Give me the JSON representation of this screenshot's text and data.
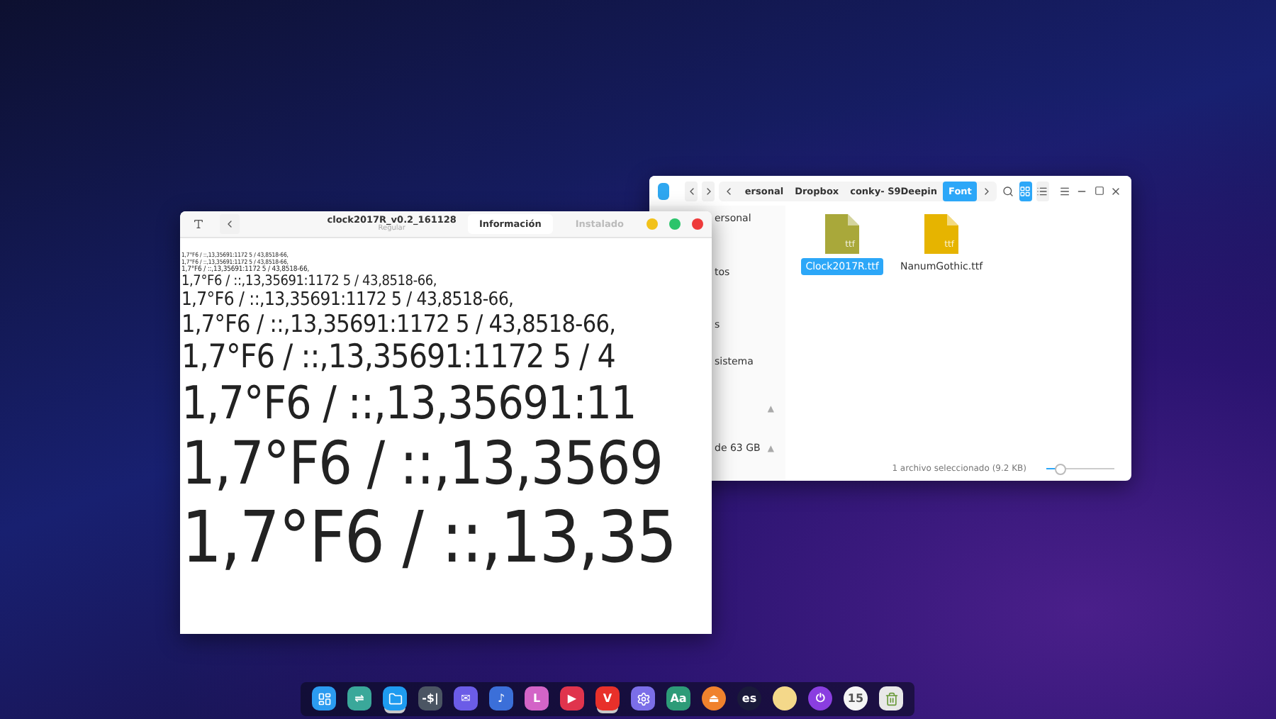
{
  "file_manager": {
    "breadcrumb": [
      {
        "label": "ersonal",
        "selected": false
      },
      {
        "label": "Dropbox",
        "selected": false
      },
      {
        "label": "conky- S9Deepin",
        "selected": false
      },
      {
        "label": "Font",
        "selected": true
      }
    ],
    "view_modes": [
      {
        "kind": "grid",
        "selected": true
      },
      {
        "kind": "list",
        "selected": false
      }
    ],
    "sidebar": [
      {
        "label": "ersonal"
      },
      {
        "label": "tos"
      },
      {
        "label": "s"
      },
      {
        "label": "sistema"
      },
      {
        "eject": "▲"
      },
      {
        "label": "de 63 GB",
        "eject": "▲"
      }
    ],
    "files": [
      {
        "name": "Clock2017R.ttf",
        "ext": "ttf",
        "selected": true,
        "color": "#a9a83a"
      },
      {
        "name": "NanumGothic.ttf",
        "ext": "ttf",
        "selected": false,
        "color": "#e6b400"
      }
    ],
    "status": "1 archivo seleccionado (9.2 KB)",
    "zoom": {
      "level": 0.2
    }
  },
  "font_viewer": {
    "title": "clock2017R_v0.2_161128",
    "subtitle": "Regular",
    "tabs": [
      {
        "label": "Información",
        "selected": true
      },
      {
        "label": "Instalado",
        "selected": false
      }
    ],
    "preview_lines": [
      "1,7°F6 / ::,13,35691:1172 5 / 43,8518-66,",
      "1,7°F6 / ::,13,35691:1172 5 / 43,8518-66,",
      "1,7°F6 / ::,13,35691:1172 5 / 43,8518-66,",
      "1,7°F6 / ::,13,35691:1172 5 / 43,8518-66,",
      "1,7°F6 / ::,13,35691:1172 5 / 43,8518-66,",
      "1,7°F6 / ::,13,35691:1172 5 / 43,8518-66,",
      "1,7°F6 / ::,13,35691:1172 5 / 4",
      "1,7°F6 / ::,13,35691:11",
      "1,7°F6 / ::,13,3569",
      "1,7°F6 / ::,13,35"
    ]
  },
  "dock": [
    {
      "kind": "launcher",
      "color": "#2b9bf0",
      "running": false
    },
    {
      "kind": "glyph",
      "color": "#3aa89a",
      "glyph": "⇌",
      "running": false
    },
    {
      "kind": "folder",
      "color": "#1e9bf0",
      "running": true
    },
    {
      "kind": "glyph",
      "color": "#4b5563",
      "glyph": "-$|",
      "running": false
    },
    {
      "kind": "glyph",
      "color": "#6b5ce7",
      "glyph": "✉",
      "running": false
    },
    {
      "kind": "glyph",
      "color": "#3b6fd9",
      "glyph": "♪",
      "running": false
    },
    {
      "kind": "glyph",
      "color": "#d364c7",
      "glyph": "L",
      "running": false
    },
    {
      "kind": "glyph",
      "color": "#e0344d",
      "glyph": "▶",
      "running": false
    },
    {
      "kind": "glyph",
      "color": "#e8302a",
      "glyph": "V",
      "running": true
    },
    {
      "kind": "gear",
      "color": "#7b6ee8",
      "running": false
    },
    {
      "kind": "glyph",
      "color": "#2d9b78",
      "glyph": "Aa",
      "running": false
    },
    {
      "kind": "glyph",
      "color": "#f0822d",
      "glyph": "⏏",
      "running": false
    },
    {
      "kind": "ring",
      "color": "#1a1a3a",
      "glyph": "es",
      "running": false
    },
    {
      "kind": "ring",
      "color": "#f4d88a",
      "running": false
    },
    {
      "kind": "glyph",
      "color": "#8a3ee0",
      "glyph": "⏻",
      "running": false
    },
    {
      "kind": "ring",
      "color": "#f5f5f5",
      "glyph": "15",
      "running": false
    },
    {
      "kind": "trash",
      "color": "#e8e8e8",
      "running": false
    }
  ]
}
